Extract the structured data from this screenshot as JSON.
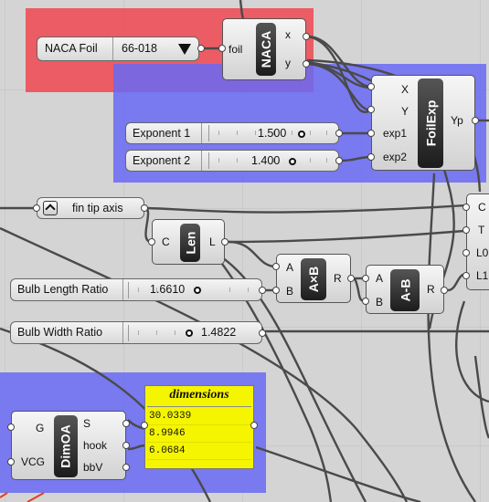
{
  "colors": {
    "group_red": "#f04650",
    "group_blue": "#6969f5",
    "panel_yellow": "#f5f500",
    "wire": "#4a4a4a"
  },
  "naca": {
    "name": "NACA Foil",
    "value": "66-018",
    "arrow_icon": "dropdown-triangle"
  },
  "naca_comp": {
    "tag": "NACA",
    "input": "foil",
    "outputs": [
      "x",
      "y"
    ]
  },
  "foilexp": {
    "tag": "FoilExp",
    "inputs": [
      "X",
      "Y",
      "exp1",
      "exp2"
    ],
    "output": "Yp"
  },
  "exponent1": {
    "name": "Exponent 1",
    "value": "1.500"
  },
  "exponent2": {
    "name": "Exponent 2",
    "value": "1.400"
  },
  "fin_tip": {
    "label": "fin tip axis",
    "icon": "toggle-arrow-icon"
  },
  "len_comp": {
    "tag": "Len",
    "input": "C",
    "output": "L"
  },
  "axb_comp": {
    "tag": "A×B",
    "inputs": [
      "A",
      "B"
    ],
    "output": "R"
  },
  "amb_comp": {
    "tag": "A-B",
    "inputs": [
      "A",
      "B"
    ],
    "output": "R"
  },
  "right_comp": {
    "inputs": [
      "C",
      "T",
      "L0",
      "L1"
    ]
  },
  "bulb_length": {
    "name": "Bulb Length Ratio",
    "value": "1.6610"
  },
  "bulb_width": {
    "name": "Bulb Width Ratio",
    "value": "1.4822"
  },
  "dimoa": {
    "tag": "DimOA",
    "inputs": [
      "G",
      "VCG"
    ],
    "outputs": [
      "S",
      "hook",
      "bbV"
    ]
  },
  "dimensions_panel": {
    "title": "dimensions",
    "rows": [
      "30.0339",
      "8.9946",
      "6.0684"
    ]
  }
}
